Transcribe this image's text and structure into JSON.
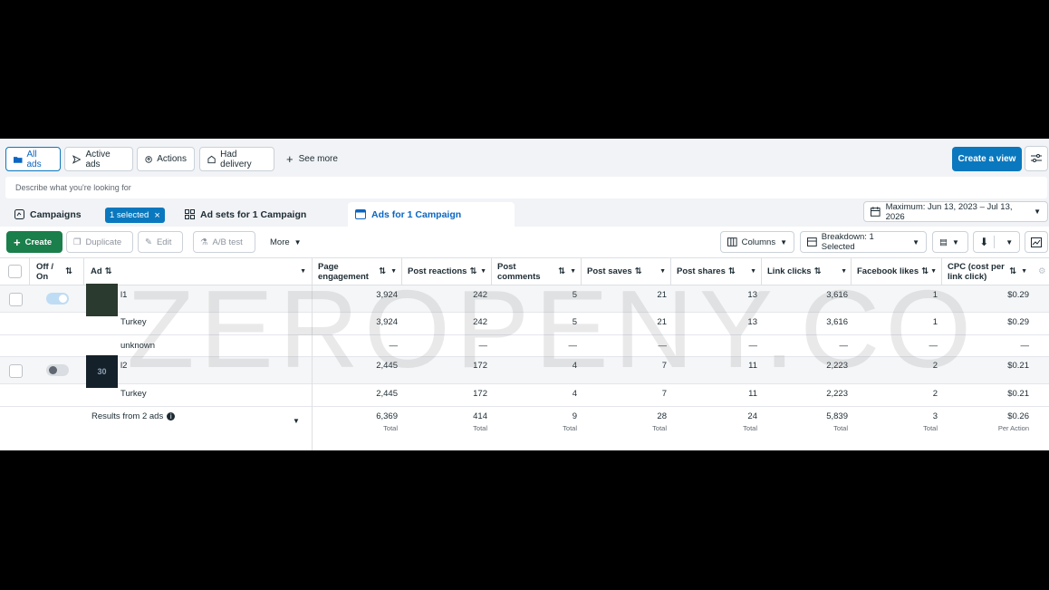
{
  "views": {
    "all_ads": "All ads",
    "active_ads": "Active ads",
    "actions": "Actions",
    "had_delivery": "Had delivery",
    "see_more": "See more",
    "create_view": "Create a view"
  },
  "search": {
    "placeholder": "Describe what you're looking for"
  },
  "tabs": {
    "campaigns": "Campaigns",
    "selected": "1 selected",
    "ad_sets": "Ad sets for 1 Campaign",
    "ads": "Ads for 1 Campaign"
  },
  "date_range": "Maximum: Jun 13, 2023 – Jul 13, 2026",
  "toolbar": {
    "create": "Create",
    "duplicate": "Duplicate",
    "edit": "Edit",
    "ab_test": "A/B test",
    "more": "More",
    "columns": "Columns",
    "breakdown": "Breakdown: 1 Selected"
  },
  "table": {
    "headers": {
      "off_on": "Off / On",
      "ad": "Ad",
      "page_engagement": "Page engagement",
      "post_reactions": "Post reactions",
      "post_comments": "Post comments",
      "post_saves": "Post saves",
      "post_shares": "Post shares",
      "link_clicks": "Link clicks",
      "facebook_likes": "Facebook likes",
      "cpc": "CPC (cost per link click)"
    },
    "rows": [
      {
        "name": "l1",
        "values": [
          "3,924",
          "242",
          "5",
          "21",
          "13",
          "3,616",
          "1",
          "$0.29"
        ]
      },
      {
        "name": "Turkey",
        "values": [
          "3,924",
          "242",
          "5",
          "21",
          "13",
          "3,616",
          "1",
          "$0.29"
        ]
      },
      {
        "name": "unknown",
        "values": [
          "—",
          "—",
          "—",
          "—",
          "—",
          "—",
          "—",
          "—"
        ]
      },
      {
        "name": "l2",
        "values": [
          "2,445",
          "172",
          "4",
          "7",
          "11",
          "2,223",
          "2",
          "$0.21"
        ]
      },
      {
        "name": "Turkey",
        "values": [
          "2,445",
          "172",
          "4",
          "7",
          "11",
          "2,223",
          "2",
          "$0.21"
        ]
      }
    ],
    "results_label": "Results from 2 ads",
    "totals": [
      "6,369",
      "414",
      "9",
      "28",
      "24",
      "5,839",
      "3",
      "$0.26"
    ],
    "total_labels": [
      "Total",
      "Total",
      "Total",
      "Total",
      "Total",
      "Total",
      "Total",
      "Per Action"
    ],
    "thumb2_text": "30"
  },
  "watermark": "ZEROPENY.CO"
}
